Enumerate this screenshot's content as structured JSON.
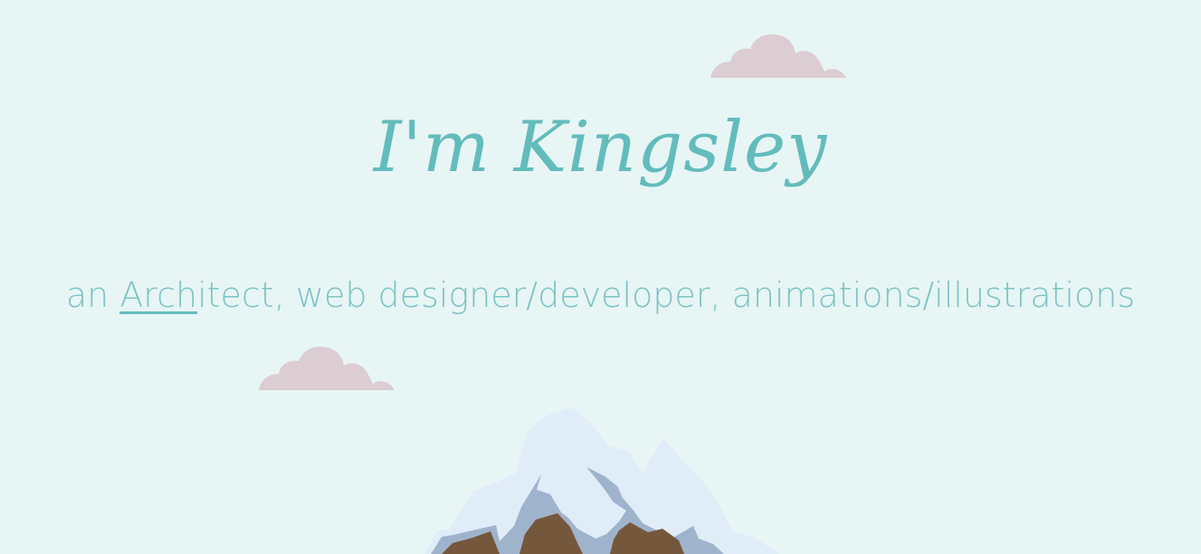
{
  "hero": {
    "title": "I'm Kingsley",
    "tagline_prefix": "an ",
    "tagline_typed": "Arch",
    "tagline_typed_rest": "itect",
    "tagline_suffix": ", web designer/developer, animations/illustrations"
  },
  "illustration": {
    "clouds": [
      "cloud",
      "cloud"
    ],
    "mountain": "mountain"
  },
  "colors": {
    "background": "#e8f5f5",
    "title": "#63bcbc",
    "tagline": "#7cc4c4",
    "cloud": "#dbcdd2",
    "snow": "#e0edf8",
    "rock_shadow": "#9fb3cc",
    "rock": "#75573b"
  }
}
